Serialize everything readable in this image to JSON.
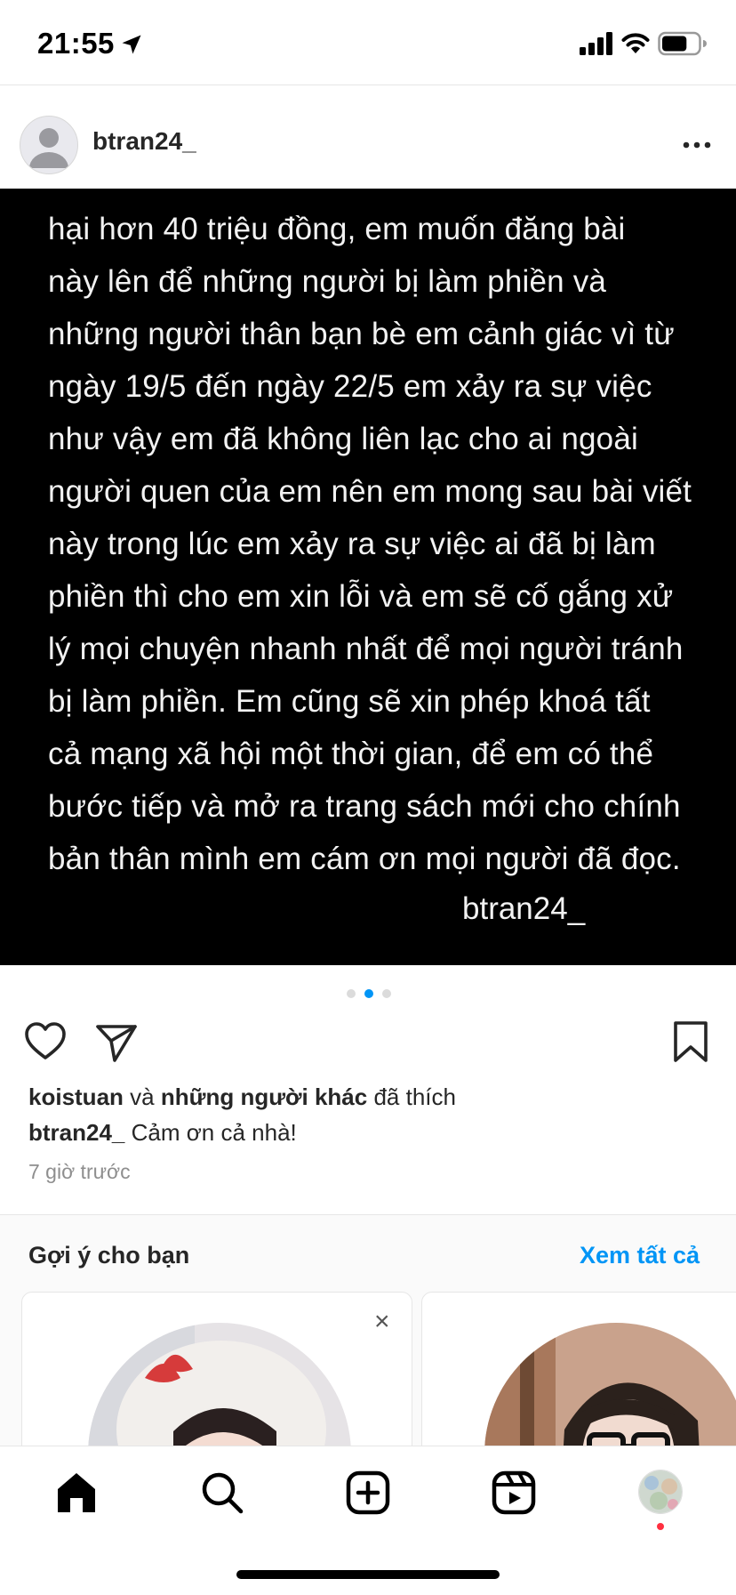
{
  "status_bar": {
    "time": "21:55",
    "battery_percent": 70
  },
  "post": {
    "username": "btran24_",
    "image_text_lines": [
      "hại hơn 40 triệu đồng, em muốn đăng bài",
      "này lên để những người bị làm phiền và",
      "những người thân bạn bè em cảnh giác vì từ",
      "ngày  19/5 đến ngày 22/5 em xảy ra sự việc",
      "như vậy em đã không liên lạc cho ai ngoài",
      "người quen của em nên em mong sau bài viết",
      "này trong lúc em xảy ra sự việc ai đã bị làm",
      "phiền thì cho em xin lỗi và em sẽ cố gắng xử",
      "lý mọi chuyện nhanh nhất để mọi người tránh",
      "bị làm phiền. Em cũng sẽ xin phép khoá tất",
      "cả mạng xã hội một thời gian, để em có thể",
      "bước tiếp và mở ra trang sách mới cho chính",
      "bản thân mình em cám ơn mọi người đã đọc."
    ],
    "image_signature": "btran24_",
    "carousel": {
      "count": 3,
      "active": 2
    },
    "likes": {
      "user": "koistuan",
      "conj": "và",
      "others": "những người khác",
      "suffix": "đã thích"
    },
    "caption": {
      "username": "btran24_",
      "text": "Cảm ơn cả nhà!"
    },
    "timestamp": "7 giờ trước"
  },
  "suggestions": {
    "title": "Gợi ý cho bạn",
    "see_all": "Xem tất cả",
    "close_symbol": "×"
  },
  "colors": {
    "accent": "#0095f6",
    "notification": "#ff3040",
    "text": "#262626",
    "muted": "#8e8e8e"
  },
  "icons": {
    "status": [
      "location-arrow-icon",
      "signal-icon",
      "wifi-icon",
      "battery-icon"
    ],
    "actions": [
      "heart-icon",
      "send-icon",
      "bookmark-icon"
    ],
    "tabs": [
      "home-icon",
      "search-icon",
      "add-post-icon",
      "reels-icon",
      "profile-avatar"
    ]
  }
}
